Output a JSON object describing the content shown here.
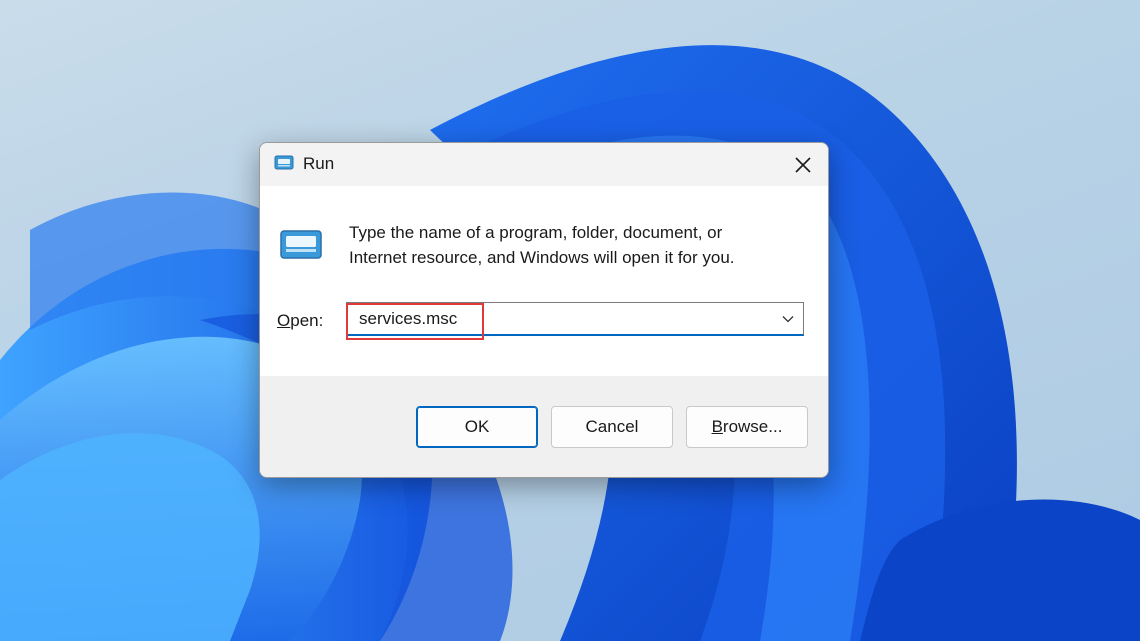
{
  "dialog": {
    "title": "Run",
    "close_icon": "close-icon",
    "description_line1": "Type the name of a program, folder, document, or",
    "description_line2": "Internet resource, and Windows will open it for you.",
    "open_label_access": "O",
    "open_label_rest": "pen:",
    "input_value": "services.msc",
    "buttons": {
      "ok": "OK",
      "cancel": "Cancel",
      "browse_access": "B",
      "browse_rest": "rowse..."
    }
  },
  "colors": {
    "accent": "#0067c0",
    "highlight": "#e0393b"
  }
}
